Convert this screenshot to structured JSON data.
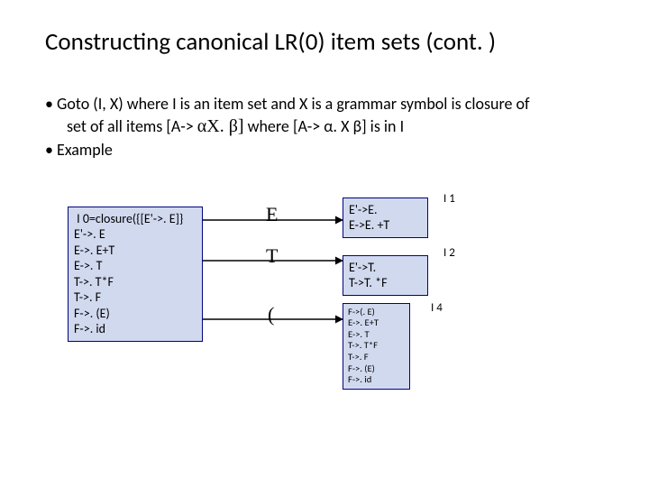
{
  "title": "Constructing canonical LR(0) item sets (cont. )",
  "bullet1": "• Goto (I, X) where I is an item set and X is a grammar symbol is closure of",
  "bullet2_pre": "set of all items [A-> ",
  "bullet2_greek": "αX. β]",
  "bullet2_post": " where [A-> α. X β] is in I",
  "bullet3": "• Example",
  "edges": {
    "E": "E",
    "T": "T",
    "P": "("
  },
  "labels": {
    "I1": "I 1",
    "I2": "I 2",
    "I4": "I 4"
  },
  "I0": " I 0=closure({[E'->. E]}\nE'->. E\nE->. E+T\nE->. T\nT->. T*F\nT->. F\nF->. (E)\nF->. id",
  "I1_box": "E'->E.\nE->E. +T",
  "I2_box": "E'->T.\nT->T. *F",
  "I4_box": "F->(. E)\nE->. E+T\nE->. T\nT->. T*F\nT->. F\nF->. (E)\nF->. id"
}
